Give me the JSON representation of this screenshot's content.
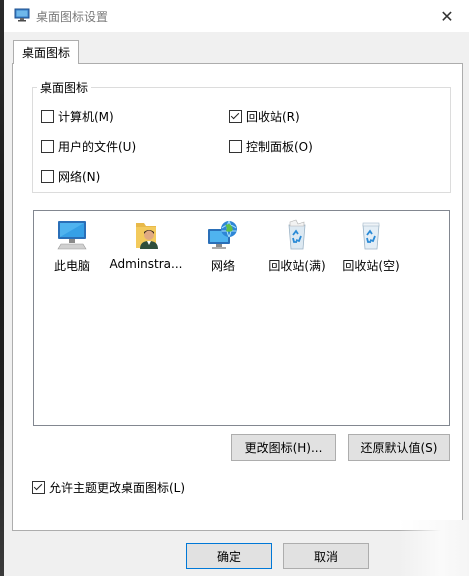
{
  "window": {
    "title": "桌面图标设置",
    "close_glyph": "✕"
  },
  "tabs": [
    {
      "label": "桌面图标"
    }
  ],
  "group": {
    "label": "桌面图标",
    "checkboxes": [
      {
        "label": "计算机(M)",
        "checked": false
      },
      {
        "label": "回收站(R)",
        "checked": true
      },
      {
        "label": "用户的文件(U)",
        "checked": false
      },
      {
        "label": "控制面板(O)",
        "checked": false
      },
      {
        "label": "网络(N)",
        "checked": false
      }
    ]
  },
  "icons": [
    {
      "label": "此电脑",
      "icon": "computer-icon"
    },
    {
      "label": "Adminstra...",
      "icon": "user-folder-icon"
    },
    {
      "label": "网络",
      "icon": "network-icon"
    },
    {
      "label": "回收站(满)",
      "icon": "recycle-bin-full-icon"
    },
    {
      "label": "回收站(空)",
      "icon": "recycle-bin-empty-icon"
    }
  ],
  "buttons": {
    "change_icon": "更改图标(H)...",
    "restore_default": "还原默认值(S)",
    "ok": "确定",
    "cancel": "取消"
  },
  "allow_theme": {
    "label": "允许主题更改桌面图标(L)",
    "checked": true
  },
  "colors": {
    "accent": "#0078d7",
    "title_text": "#7a7a7a"
  }
}
